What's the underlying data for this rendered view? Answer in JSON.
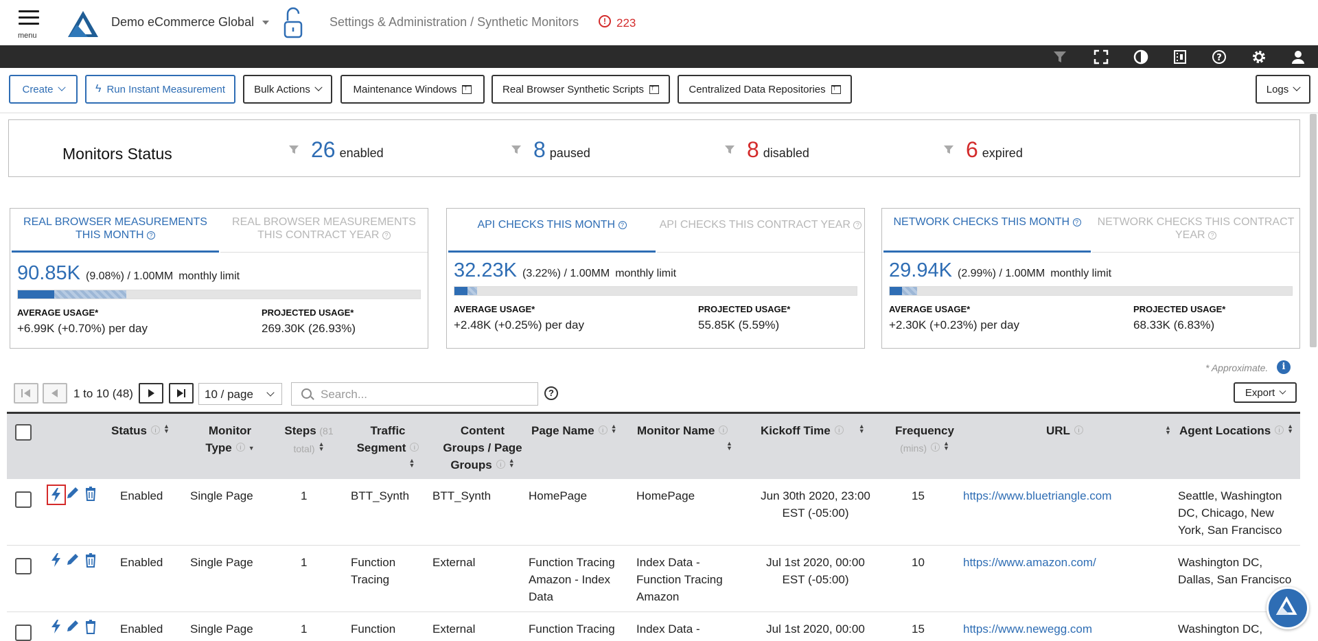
{
  "header": {
    "menu_label": "menu",
    "tenant": "Demo eCommerce Global",
    "breadcrumb": "Settings & Administration / Synthetic Monitors",
    "alert_count": "223"
  },
  "toolbar": {
    "create": "Create",
    "run_instant": "Run Instant Measurement",
    "bulk_actions": "Bulk Actions",
    "maintenance": "Maintenance Windows",
    "scripts": "Real Browser Synthetic Scripts",
    "repos": "Centralized Data Repositories",
    "logs": "Logs"
  },
  "monitors_status": {
    "title": "Monitors Status",
    "enabled": {
      "count": "26",
      "label": "enabled"
    },
    "paused": {
      "count": "8",
      "label": "paused"
    },
    "disabled": {
      "count": "8",
      "label": "disabled"
    },
    "expired": {
      "count": "6",
      "label": "expired"
    }
  },
  "usage_cards": [
    {
      "tab_active": "REAL BROWSER MEASUREMENTS THIS MONTH",
      "tab_inactive": "REAL BROWSER MEASUREMENTS THIS CONTRACT YEAR",
      "value": "90.85K",
      "detail": "(9.08%) / 1.00MM",
      "limit_label": "monthly limit",
      "used_fraction": 0.0908,
      "projected_fraction": 0.2693,
      "avg_label": "AVERAGE USAGE*",
      "avg_value": "+6.99K (+0.70%) per day",
      "proj_label": "PROJECTED USAGE*",
      "proj_value": "269.30K (26.93%)"
    },
    {
      "tab_active": "API CHECKS THIS MONTH",
      "tab_inactive": "API CHECKS THIS CONTRACT YEAR",
      "value": "32.23K",
      "detail": "(3.22%) / 1.00MM",
      "limit_label": "monthly limit",
      "used_fraction": 0.0322,
      "projected_fraction": 0.0559,
      "avg_label": "AVERAGE USAGE*",
      "avg_value": "+2.48K (+0.25%) per day",
      "proj_label": "PROJECTED USAGE*",
      "proj_value": "55.85K (5.59%)"
    },
    {
      "tab_active": "NETWORK CHECKS THIS MONTH",
      "tab_inactive": "NETWORK CHECKS THIS CONTRACT YEAR",
      "value": "29.94K",
      "detail": "(2.99%) / 1.00MM",
      "limit_label": "monthly limit",
      "used_fraction": 0.0299,
      "projected_fraction": 0.0683,
      "avg_label": "AVERAGE USAGE*",
      "avg_value": "+2.30K (+0.23%) per day",
      "proj_label": "PROJECTED USAGE*",
      "proj_value": "68.33K (6.83%)"
    }
  ],
  "approx_note": "* Approximate.",
  "pagination": {
    "range": "1 to 10 (48)",
    "per_page": "10 / page",
    "search_placeholder": "Search..."
  },
  "export_label": "Export",
  "table": {
    "headers": {
      "status": "Status",
      "monitor_type_1": "Monitor",
      "monitor_type_2": "Type",
      "steps": "Steps",
      "steps_sub_1": "(81",
      "steps_sub_2": "total)",
      "traffic_1": "Traffic",
      "traffic_2": "Segment",
      "content_1": "Content",
      "content_2": "Groups / Page",
      "content_3": "Groups",
      "page_name": "Page Name",
      "monitor_name": "Monitor Name",
      "kickoff": "Kickoff Time",
      "frequency": "Frequency",
      "frequency_sub": "(mins)",
      "url": "URL",
      "agents": "Agent Locations"
    },
    "rows": [
      {
        "status": "Enabled",
        "type": "Single Page",
        "steps": "1",
        "traffic": [
          "BTT_Synth"
        ],
        "content": [
          "BTT_Synth"
        ],
        "page_name": [
          "HomePage"
        ],
        "monitor_name": [
          "HomePage"
        ],
        "kickoff": [
          "Jun 30th 2020, 23:00",
          "EST (-05:00)"
        ],
        "frequency": "15",
        "url": "https://www.bluetriangle.com",
        "agents": [
          "Seattle, Washington",
          "DC, Chicago, New",
          "York, San Francisco"
        ]
      },
      {
        "status": "Enabled",
        "type": "Single Page",
        "steps": "1",
        "traffic": [
          "Function",
          "Tracing"
        ],
        "content": [
          "External"
        ],
        "page_name": [
          "Function Tracing",
          "Amazon - Index",
          "Data"
        ],
        "monitor_name": [
          "Index Data -",
          "Function Tracing",
          "Amazon"
        ],
        "kickoff": [
          "Jul 1st 2020, 00:00",
          "EST (-05:00)"
        ],
        "frequency": "10",
        "url": "https://www.amazon.com/",
        "agents": [
          "Washington DC,",
          "Dallas, San Francisco"
        ]
      },
      {
        "status": "Enabled",
        "type": "Single Page",
        "steps": "1",
        "traffic": [
          "Function"
        ],
        "content": [
          "External"
        ],
        "page_name": [
          "Function Tracing"
        ],
        "monitor_name": [
          "Index Data -"
        ],
        "kickoff": [
          "Jul 1st 2020, 00:00"
        ],
        "frequency": "15",
        "url": "https://www.newegg.com",
        "agents": [
          "Washington DC,"
        ]
      }
    ]
  },
  "colors": {
    "accent": "#2e6db4",
    "danger": "#d32b2b",
    "success": "#4a9a2a",
    "dark_bar": "#2b2b2b"
  }
}
